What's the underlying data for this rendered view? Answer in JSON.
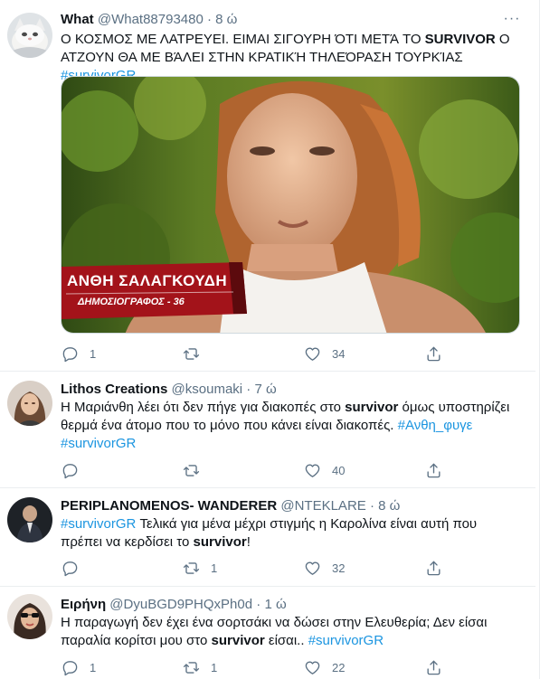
{
  "tweets": [
    {
      "name": "What",
      "handle": "@What88793480",
      "time": "8 ώ",
      "text_parts": [
        {
          "t": "Ο ΚΟΣΜΟΣ ΜΕ ΛΑΤΡΕΥΕΙ. ΕΙΜΑΙ ΣΙΓΟΥΡΗ ΌΤΙ ΜΕΤΆ ΤΟ "
        },
        {
          "t": "SURVIVOR",
          "b": true
        },
        {
          "t": " Ο ΑΤΖΟΥΝ ΘΑ ΜΕ ΒΆΛΕΙ ΣΤΗΝ ΚΡΑΤΙΚΉ ΤΗΛΕΌΡΑΣΗ ΤΟΥΡΚΊΑΣ "
        },
        {
          "t": "#survivorGR",
          "tag": true
        }
      ],
      "media": {
        "lower_third_name": "ΑΝΘΗ ΣΑΛΑΓΚΟΥΔΗ",
        "lower_third_role": "ΔΗΜΟΣΙΟΓΡΑΦΟΣ - 36"
      },
      "replies": "1",
      "retweets": "",
      "likes": "34"
    },
    {
      "name": "Lithos Creations",
      "handle": "@ksoumaki",
      "time": "7 ώ",
      "text_parts": [
        {
          "t": "Η Μαριάνθη λέει ότι δεν πήγε για διακοπές στο "
        },
        {
          "t": "survivor",
          "b": true
        },
        {
          "t": " όμως υποστηρίζει θερμά ένα άτομο που το μόνο που κάνει είναι διακοπές. "
        },
        {
          "t": "#Ανθη_φυγε",
          "tag": true
        },
        {
          "t": " "
        },
        {
          "t": "#survivorGR",
          "tag": true
        }
      ],
      "replies": "",
      "retweets": "",
      "likes": "40"
    },
    {
      "name": "PERIPLANOMENOS- WANDERER",
      "handle": "@NTEKLARE",
      "time": "8 ώ",
      "text_parts": [
        {
          "t": "#survivorGR",
          "tag": true
        },
        {
          "t": " Τελικά για μένα μέχρι στιγμής η Καρολίνα είναι αυτή που πρέπει να κερδίσει το "
        },
        {
          "t": "survivor",
          "b": true
        },
        {
          "t": "!"
        }
      ],
      "replies": "",
      "retweets": "1",
      "likes": "32"
    },
    {
      "name": "Ειρήνη",
      "handle": "@DyuBGD9PHQxPh0d",
      "time": "1 ώ",
      "text_parts": [
        {
          "t": "Η παραγωγή δεν έχει ένα σορτσάκι να δώσει στην Ελευθερία; Δεν είσαι παραλία κορίτσι μου στο "
        },
        {
          "t": "survivor",
          "b": true
        },
        {
          "t": " είσαι.. "
        },
        {
          "t": "#survivorGR",
          "tag": true
        }
      ],
      "replies": "1",
      "retweets": "1",
      "likes": "22"
    }
  ],
  "ui": {
    "dot": "·",
    "more_glyph": "···",
    "reply_icon": "reply-icon",
    "retweet_icon": "retweet-icon",
    "like_icon": "heart-icon",
    "share_icon": "share-icon",
    "link_color": "#1b95e0",
    "muted_color": "#5b7083"
  }
}
